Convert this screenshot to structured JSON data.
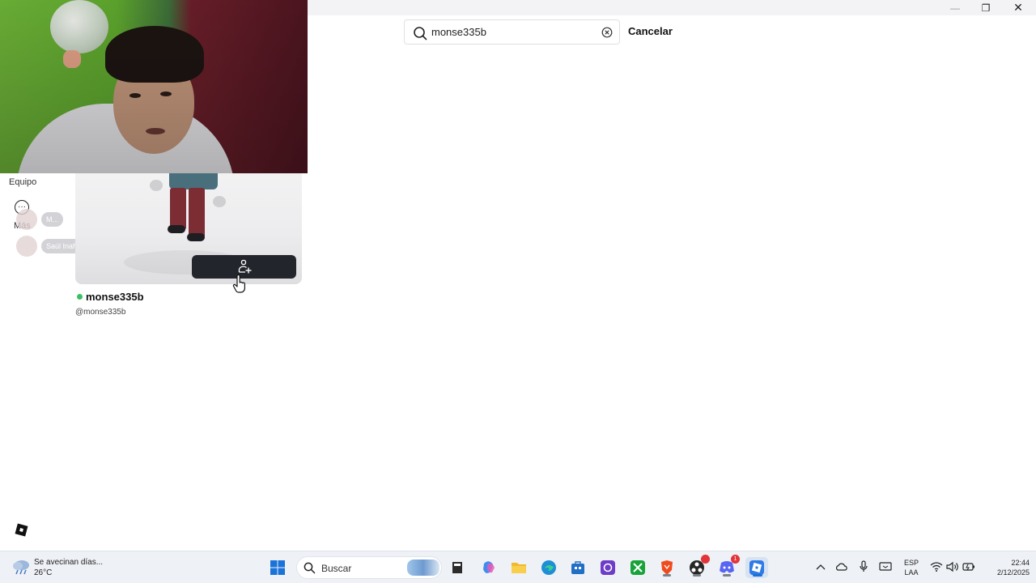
{
  "window": {
    "minimize": "—",
    "restore": "❐",
    "close": "✕"
  },
  "sidebar": {
    "equipo_label": "Equipo",
    "mas_label": "Más",
    "chips": [
      {
        "label": "M..."
      },
      {
        "label": "Saúl Inafran"
      }
    ]
  },
  "search": {
    "value": "monse335b",
    "cancel_label": "Cancelar"
  },
  "profile": {
    "display_name": "monse335b",
    "username": "@monse335b",
    "status": "online"
  },
  "colors": {
    "online": "#3bbf64",
    "add_friend_button": "#23252c",
    "taskbar_bg": "#eef1f6"
  },
  "taskbar": {
    "weather_title": "Se avecinan días...",
    "weather_temp": "26°C",
    "search_label": "Buscar",
    "apps": [
      "start-icon",
      "file-explorer-icon",
      "copilot-icon",
      "folder-icon",
      "edge-icon",
      "store-icon",
      "proton-vpn-icon",
      "xbox-icon",
      "brave-icon",
      "obs-icon",
      "discord-icon",
      "roblox-icon"
    ],
    "discord_badge": "1",
    "language_1": "ESP",
    "language_2": "LAA",
    "time": "22:44",
    "date": "2/12/2025"
  }
}
